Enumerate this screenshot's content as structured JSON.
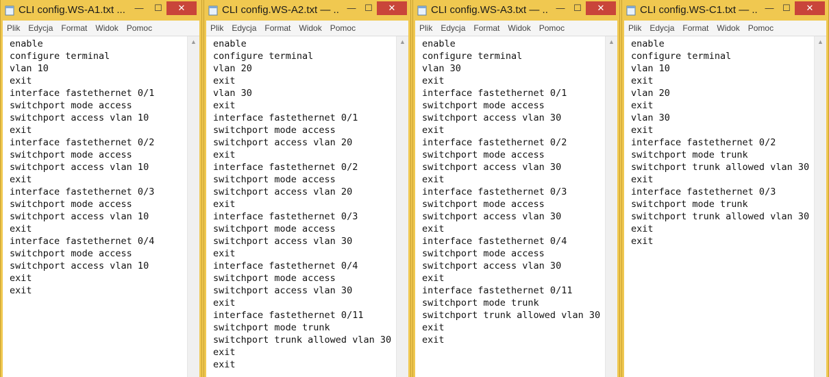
{
  "menu": [
    "Plik",
    "Edycja",
    "Format",
    "Widok",
    "Pomoc"
  ],
  "controls": {
    "minimize": "—",
    "maximize": "☐",
    "close": "✕"
  },
  "colors": {
    "taskbar_bg": "#f0c850",
    "close_button": "#c9453a"
  },
  "windows": [
    {
      "title": "CLI config.WS-A1.txt ...",
      "lines": [
        "enable",
        "configure terminal",
        "vlan 10",
        "exit",
        "interface fastethernet 0/1",
        "switchport mode access",
        "switchport access vlan 10",
        "exit",
        "interface fastethernet 0/2",
        "switchport mode access",
        "switchport access vlan 10",
        "exit",
        "interface fastethernet 0/3",
        "switchport mode access",
        "switchport access vlan 10",
        "exit",
        "interface fastethernet 0/4",
        "switchport mode access",
        "switchport access vlan 10",
        "exit",
        "exit"
      ]
    },
    {
      "title": "CLI config.WS-A2.txt — ...",
      "lines": [
        "enable",
        "configure terminal",
        "vlan 20",
        "exit",
        "vlan 30",
        "exit",
        "interface fastethernet 0/1",
        "switchport mode access",
        "switchport access vlan 20",
        "exit",
        "interface fastethernet 0/2",
        "switchport mode access",
        "switchport access vlan 20",
        "exit",
        "interface fastethernet 0/3",
        "switchport mode access",
        "switchport access vlan 30",
        "exit",
        "interface fastethernet 0/4",
        "switchport mode access",
        "switchport access vlan 30",
        "exit",
        "interface fastethernet 0/11",
        "switchport mode trunk",
        "switchport trunk allowed vlan 30",
        "exit",
        "exit"
      ]
    },
    {
      "title": "CLI config.WS-A3.txt — ...",
      "lines": [
        "enable",
        "configure terminal",
        "vlan 30",
        "exit",
        "interface fastethernet 0/1",
        "switchport mode access",
        "switchport access vlan 30",
        "exit",
        "interface fastethernet 0/2",
        "switchport mode access",
        "switchport access vlan 30",
        "exit",
        "interface fastethernet 0/3",
        "switchport mode access",
        "switchport access vlan 30",
        "exit",
        "interface fastethernet 0/4",
        "switchport mode access",
        "switchport access vlan 30",
        "exit",
        "interface fastethernet 0/11",
        "switchport mode trunk",
        "switchport trunk allowed vlan 30",
        "exit",
        "exit"
      ]
    },
    {
      "title": "CLI config.WS-C1.txt — ...",
      "lines": [
        "enable",
        "configure terminal",
        "vlan 10",
        "exit",
        "vlan 20",
        "exit",
        "vlan 30",
        "exit",
        "interface fastethernet 0/2",
        "switchport mode trunk",
        "switchport trunk allowed vlan 30",
        "exit",
        "interface fastethernet 0/3",
        "switchport mode trunk",
        "switchport trunk allowed vlan 30",
        "exit",
        "exit"
      ]
    }
  ]
}
